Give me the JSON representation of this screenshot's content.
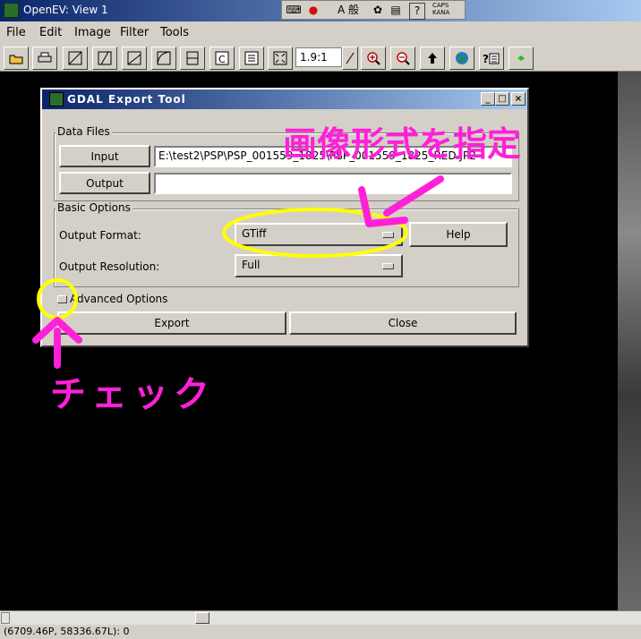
{
  "window": {
    "title": "OpenEV: View 1"
  },
  "ime": {
    "items": [
      "⌨",
      "●",
      "A 般",
      "✿",
      "▤",
      "?"
    ],
    "caps": "CAPS",
    "kana": "KANA"
  },
  "menu": [
    "File",
    "Edit",
    "Image",
    "Filter",
    "Tools"
  ],
  "toolbar": {
    "zoom": "1.9:1",
    "buttons": [
      "open-icon",
      "print-icon",
      "stretch-linear-icon",
      "stretch-2-icon",
      "stretch-3-icon",
      "stretch-4-icon",
      "split-icon",
      "c-icon",
      "layers-icon",
      "fit-icon",
      "zoom-in-icon",
      "zoom-out-icon",
      "up-arrow-icon",
      "globe-icon",
      "help-icon",
      "diamond-icon"
    ]
  },
  "dialog": {
    "title": "GDAL Export Tool",
    "data_files": {
      "label": "Data Files",
      "input_button": "Input",
      "input_path": "E:\\test2\\PSP\\PSP_001559_1825\\PSP_001559_1825_RED.JP2",
      "output_button": "Output",
      "output_path": ""
    },
    "basic_options": {
      "label": "Basic Options",
      "format_label": "Output Format:",
      "format_value": "GTiff",
      "help_button": "Help",
      "resolution_label": "Output Resolution:",
      "resolution_value": "Full"
    },
    "advanced_label": "Advanced Options",
    "export_button": "Export",
    "close_button": "Close"
  },
  "annotations": {
    "format_note": "画像形式を指定",
    "check_note": "チェック"
  },
  "status": "(6709.46P, 58336.67L): 0",
  "colors": {
    "annotation": "#ff20d8",
    "highlight": "#ffff00"
  }
}
